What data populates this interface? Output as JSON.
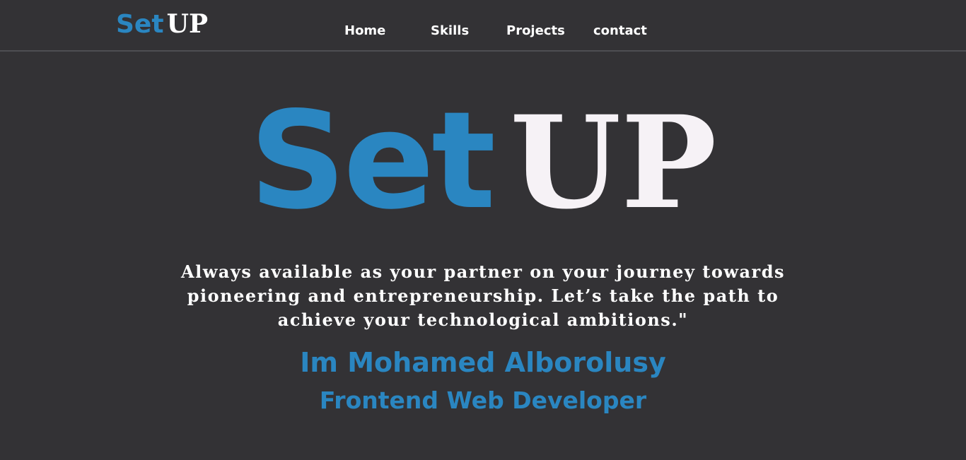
{
  "colors": {
    "background": "#333235",
    "accent": "#2a86c1",
    "text": "#ffffff"
  },
  "navbar": {
    "logo": {
      "part1": "Set",
      "part2": "UP"
    },
    "links": [
      {
        "label": "Home"
      },
      {
        "label": "Skills"
      },
      {
        "label": "Projects"
      },
      {
        "label": "contact"
      }
    ]
  },
  "hero": {
    "title": {
      "part1": "Set",
      "part2": "UP"
    },
    "tagline": "Always available as your partner on your journey towards pioneering and entrepreneurship. Let’s take the path to achieve your technological ambitions.\"",
    "name": "Im Mohamed Alborolusy",
    "role": "Frontend Web Developer"
  }
}
